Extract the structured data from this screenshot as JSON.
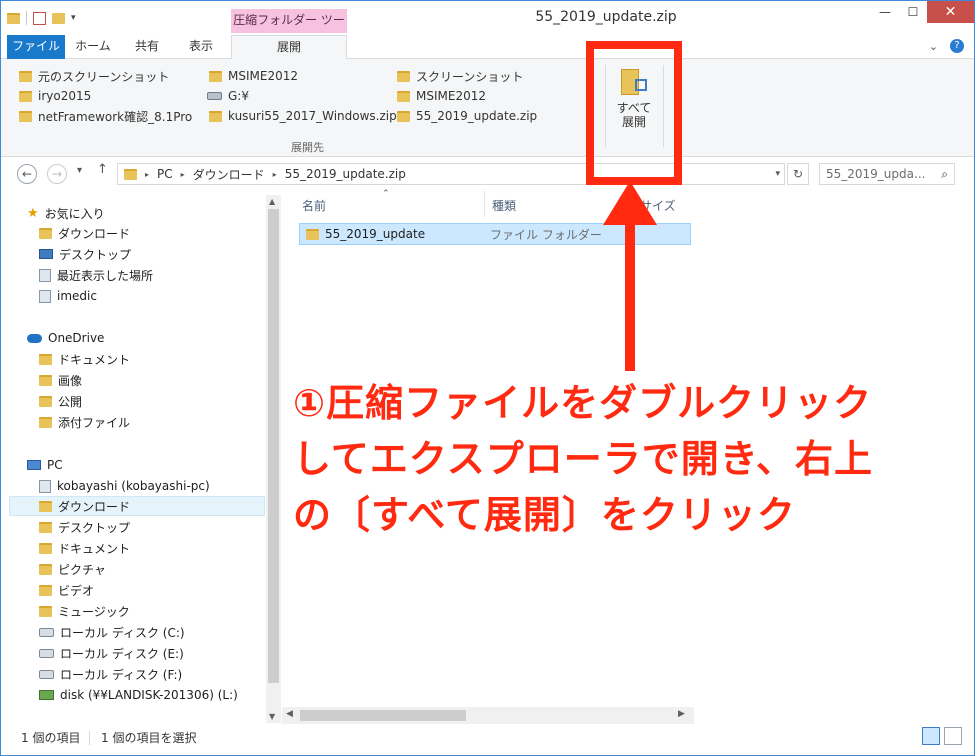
{
  "window": {
    "title": "55_2019_update.zip",
    "contextual_tab_group": "圧縮フォルダー ツール"
  },
  "ribbon_tabs": [
    "ファイル",
    "ホーム",
    "共有",
    "表示",
    "展開"
  ],
  "ribbon": {
    "destinations": [
      "元のスクリーンショット",
      "MSIME2012",
      "スクリーンショット",
      "iryo2015",
      "G:¥",
      "MSIME2012",
      "netFramework確認_8.1Pro",
      "kusuri55_2017_Windows.zip",
      "55_2019_update.zip"
    ],
    "group_label": "展開先",
    "extract_all_label_1": "すべて",
    "extract_all_label_2": "展開"
  },
  "address": {
    "crumbs": [
      "PC",
      "ダウンロード",
      "55_2019_update.zip"
    ],
    "search_placeholder": "55_2019_upda..."
  },
  "navigation": {
    "favorites": "お気に入り",
    "favorites_items": [
      "ダウンロード",
      "デスクトップ",
      "最近表示した場所",
      "imedic"
    ],
    "onedrive": "OneDrive",
    "onedrive_items": [
      "ドキュメント",
      "画像",
      "公開",
      "添付ファイル"
    ],
    "pc": "PC",
    "pc_items": [
      "kobayashi (kobayashi-pc)",
      "ダウンロード",
      "デスクトップ",
      "ドキュメント",
      "ピクチャ",
      "ビデオ",
      "ミュージック",
      "ローカル ディスク (C:)",
      "ローカル ディスク (E:)",
      "ローカル ディスク (F:)",
      "disk (¥¥LANDISK-201306) (L:)"
    ]
  },
  "columns": {
    "name": "名前",
    "type": "種類",
    "size": "サイズ"
  },
  "files": [
    {
      "name": "55_2019_update",
      "type": "ファイル フォルダー"
    }
  ],
  "annotation": {
    "line1": "①圧縮ファイルをダブルクリック",
    "line2": "してエクスプローラで開き、右上",
    "line3": "の〔すべて展開〕をクリック"
  },
  "status": {
    "count": "1 個の項目",
    "selected": "1 個の項目を選択"
  },
  "colors": {
    "highlight": "#ff2a10",
    "accent": "#1979ca",
    "selection": "#cce8ff"
  }
}
